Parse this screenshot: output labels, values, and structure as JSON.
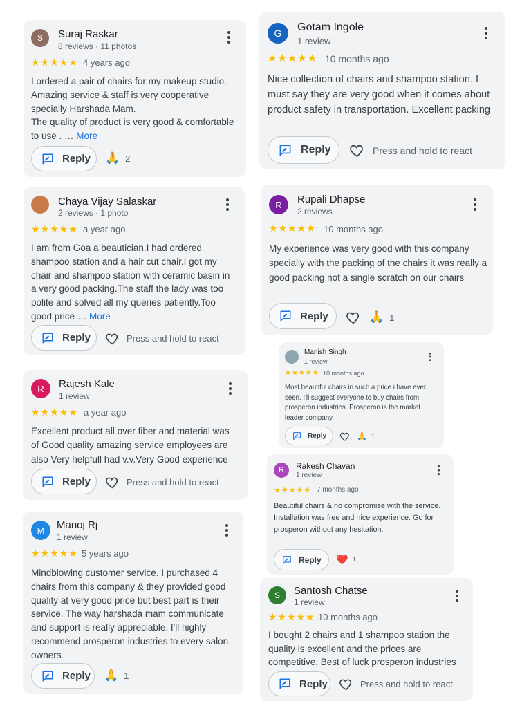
{
  "stars": "★★★★★",
  "reply_label": "Reply",
  "press_hold": "Press and hold to react",
  "more_label": "More",
  "colors": {
    "star": "#fbbc04",
    "link": "#1a73e8",
    "card": "#f1f3f4"
  },
  "reviews": [
    {
      "name": "Suraj Raskar",
      "meta": "8 reviews · 11 photos",
      "avatar_letter": "S",
      "avatar_color": "#8d6e63",
      "ago": "4 years ago",
      "text": "I ordered a pair of chairs for my makeup studio. Amazing service & staff is very cooperative specially Harshada Mam.\nThe quality of product is very good & comfortable to use . … ",
      "has_more": true,
      "reaction_emoji": "🙏",
      "reaction_count": "2"
    },
    {
      "name": "Chaya Vijay Salaskar",
      "meta": "2 reviews · 1 photo",
      "avatar_letter": "",
      "avatar_color": "#c77b48",
      "ago": "a year ago",
      "text": "I am from Goa a beautician.I had ordered shampoo station and a hair cut chair.I got my chair and shampoo station with ceramic basin in a very good packing.The staff the lady was too polite and solved all my queries patiently.Too good price … ",
      "has_more": true,
      "reaction_emoji": "",
      "reaction_count": ""
    },
    {
      "name": "Rajesh Kale",
      "meta": "1 review",
      "avatar_letter": "R",
      "avatar_color": "#d81b60",
      "ago": "a year ago",
      "text": "Excellent product all over fiber and material was of Good quality amazing service employees are also Very helpfull had v.v.Very Good experience",
      "has_more": false,
      "reaction_emoji": "",
      "reaction_count": ""
    },
    {
      "name": "Manoj Rj",
      "meta": "1 review",
      "avatar_letter": "M",
      "avatar_color": "#1e88e5",
      "ago": "5 years ago",
      "text": "Mindblowing customer service. I purchased 4 chairs from this company & they provided good quality at very good price but best part is their service. The way harshada mam communicate and support is really appreciable. I'll highly recommend prosperon industries to every salon owners.",
      "has_more": false,
      "reaction_emoji": "🙏",
      "reaction_count": "1"
    },
    {
      "name": "Gotam Ingole",
      "meta": "1 review",
      "avatar_letter": "G",
      "avatar_color": "#1565c0",
      "ago": "10 months ago",
      "text": "Nice collection of chairs and shampoo station. I must say they are very good when it comes about product safety in transportation. Excellent packing",
      "has_more": false,
      "reaction_emoji": "",
      "reaction_count": ""
    },
    {
      "name": "Rupali Dhapse",
      "meta": "2 reviews",
      "avatar_letter": "R",
      "avatar_color": "#7b1fa2",
      "ago": "10 months ago",
      "text": "My experience was very good with this company specially with the packing of the chairs it was really a good packing not a single scratch on our chairs",
      "has_more": false,
      "reaction_emoji": "🙏",
      "reaction_count": "1"
    },
    {
      "name": "Manish Singh",
      "meta": "1 review",
      "avatar_letter": "",
      "avatar_color": "#90a4ae",
      "ago": "10 months ago",
      "text": "Most beautiful chairs in such a price i have ever seen. I'll suggest everyone to buy chairs from prosperon industries. Prosperon is the market leader company.",
      "has_more": false,
      "reaction_emoji": "🙏",
      "reaction_count": "1"
    },
    {
      "name": "Rakesh Chavan",
      "meta": "1 review",
      "avatar_letter": "R",
      "avatar_color": "#ab47bc",
      "ago": "7 months ago",
      "text": "Beautiful chairs & no compromise with the service. Installation was free and nice experience. Go for prosperon without any hesitation.",
      "has_more": false,
      "reaction_emoji": "❤️",
      "reaction_count": "1"
    },
    {
      "name": "Santosh Chatse",
      "meta": "1 review",
      "avatar_letter": "S",
      "avatar_color": "#2e7d32",
      "ago": "10 months ago",
      "text": "I bought 2 chairs and 1 shampoo station the quality is excellent and the prices are competitive. Best of luck prosperon industries",
      "has_more": false,
      "reaction_emoji": "",
      "reaction_count": ""
    }
  ]
}
